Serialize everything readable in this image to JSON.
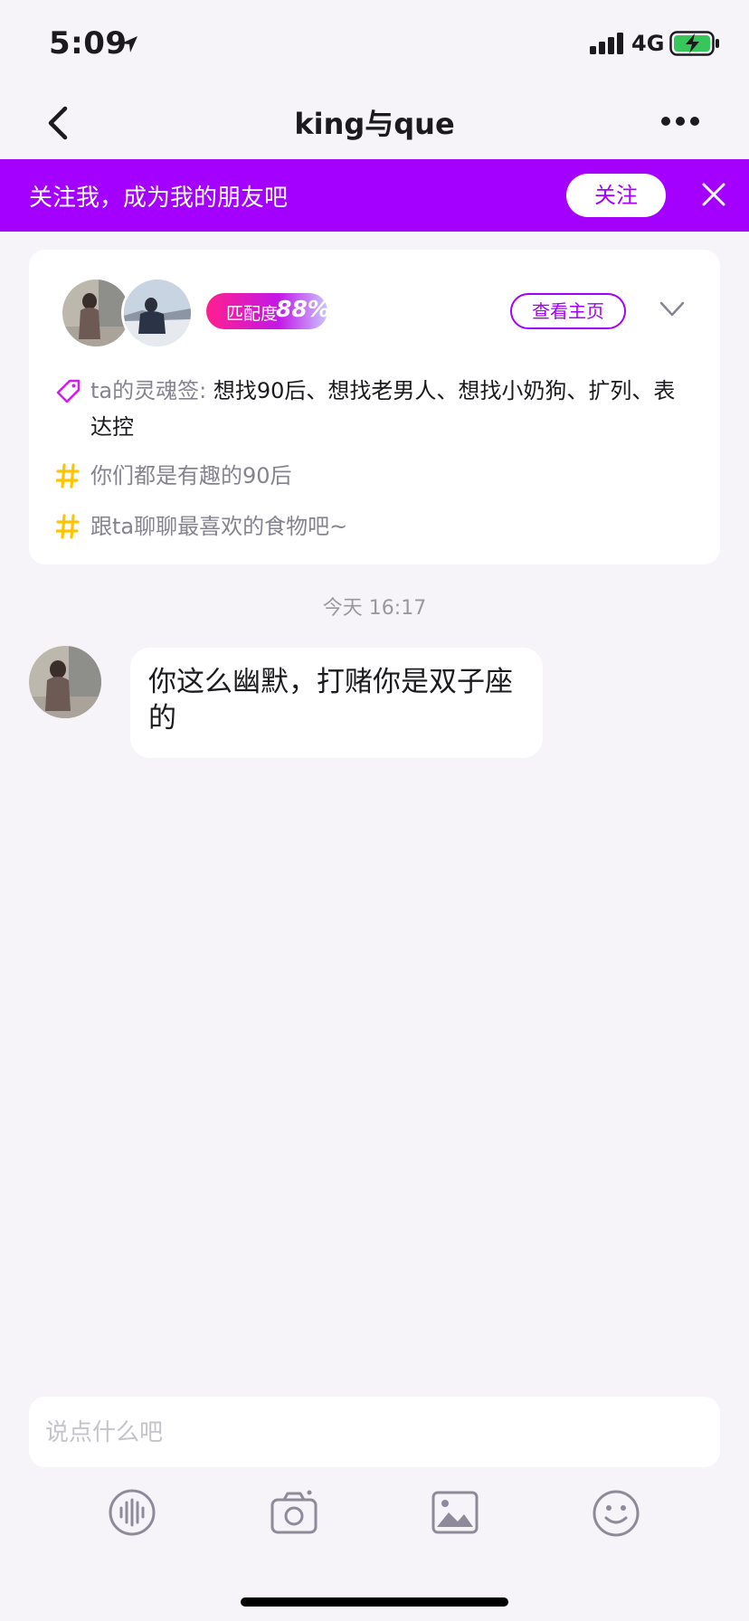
{
  "status_bar": {
    "time": "5:09",
    "network": "4G"
  },
  "nav": {
    "title": "king与que"
  },
  "follow_banner": {
    "text": "关注我，成为我的朋友吧",
    "button": "关注"
  },
  "profile_card": {
    "match_label": "匹配度",
    "match_value": "88%",
    "homepage_button": "查看主页",
    "tags": [
      {
        "label": "ta的灵魂签: ",
        "value": "想找90后、想找老男人、想找小奶狗、扩列、表达控"
      },
      {
        "text": "你们都是有趣的90后"
      },
      {
        "text": "跟ta聊聊最喜欢的食物吧~"
      }
    ]
  },
  "chat": {
    "timestamp": "今天 16:17",
    "messages": [
      {
        "text": "你这么幽默，打赌你是双子座的"
      }
    ]
  },
  "composer": {
    "placeholder": "说点什么吧"
  },
  "colors": {
    "accent": "#a300ff",
    "background": "#f6f4f8",
    "tag_icon": "#ffc400"
  }
}
